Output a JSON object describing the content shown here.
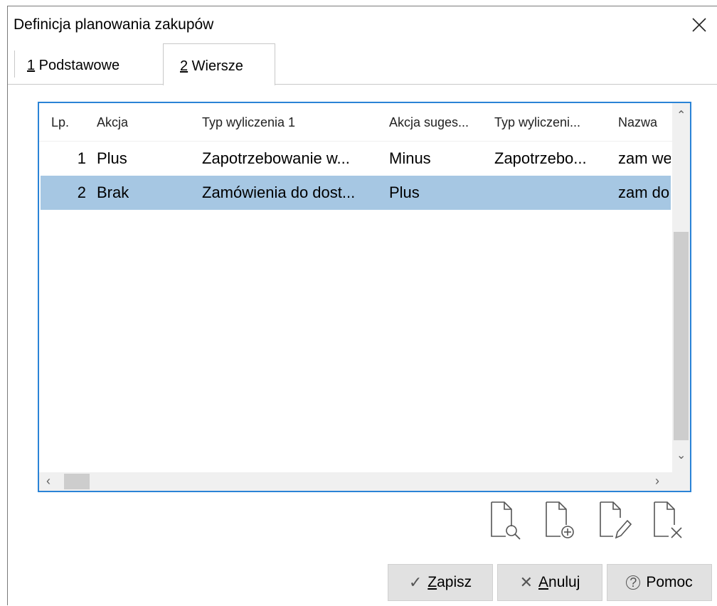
{
  "window": {
    "title": "Definicja planowania zakupów"
  },
  "tabs": [
    {
      "num": "1",
      "label": " Podstawowe"
    },
    {
      "num": "2",
      "label": " Wiersze"
    }
  ],
  "grid": {
    "columns": [
      "Lp.",
      "Akcja",
      "Typ wyliczenia 1",
      "Akcja suges...",
      "Typ wyliczeni...",
      "Nazwa"
    ],
    "rows": [
      {
        "lp": "1",
        "akcja": "Plus",
        "typ1": "Zapotrzebowanie w...",
        "akcja_sug": "Minus",
        "typ2": "Zapotrzebo...",
        "nazwa": "zam wewn"
      },
      {
        "lp": "2",
        "akcja": "Brak",
        "typ1": "Zamówienia do dost...",
        "akcja_sug": "Plus",
        "typ2": "",
        "nazwa": "zam do dost"
      }
    ],
    "selected_row": 2
  },
  "toolbar": {
    "icons": [
      "document-preview-icon",
      "document-add-icon",
      "document-edit-icon",
      "document-delete-icon"
    ]
  },
  "buttons": {
    "save_key": "Z",
    "save_rest": "apisz",
    "cancel_key": "A",
    "cancel_rest": "nuluj",
    "help_label": "Pomoc"
  },
  "colors": {
    "selection": "#a6c7e3",
    "focus_border": "#2a83d6",
    "button": "#e1e1e1"
  }
}
